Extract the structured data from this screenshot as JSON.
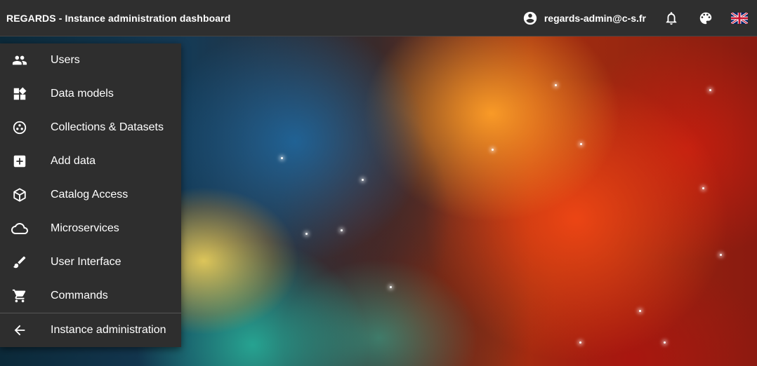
{
  "header": {
    "title": "REGARDS - Instance administration dashboard",
    "user_label": "regards-admin@c-s.fr",
    "icons": {
      "user": "account-circle-icon",
      "notifications": "bell-icon",
      "theme": "palette-icon",
      "locale": "uk-flag-icon"
    }
  },
  "menu": {
    "items": [
      {
        "label": "Users",
        "icon": "people-icon"
      },
      {
        "label": "Data models",
        "icon": "widgets-icon"
      },
      {
        "label": "Collections & Datasets",
        "icon": "bubbles-icon"
      },
      {
        "label": "Add data",
        "icon": "add-box-icon"
      },
      {
        "label": "Catalog Access",
        "icon": "cube-icon"
      },
      {
        "label": "Microservices",
        "icon": "cloud-icon"
      },
      {
        "label": "User Interface",
        "icon": "brush-icon"
      },
      {
        "label": "Commands",
        "icon": "cart-icon"
      }
    ],
    "footer_item": {
      "label": "Instance administration",
      "icon": "arrow-back-icon"
    }
  },
  "colors": {
    "topbar": "#2f2f2f",
    "menu": "#2e2e2e",
    "text": "#ffffff"
  }
}
